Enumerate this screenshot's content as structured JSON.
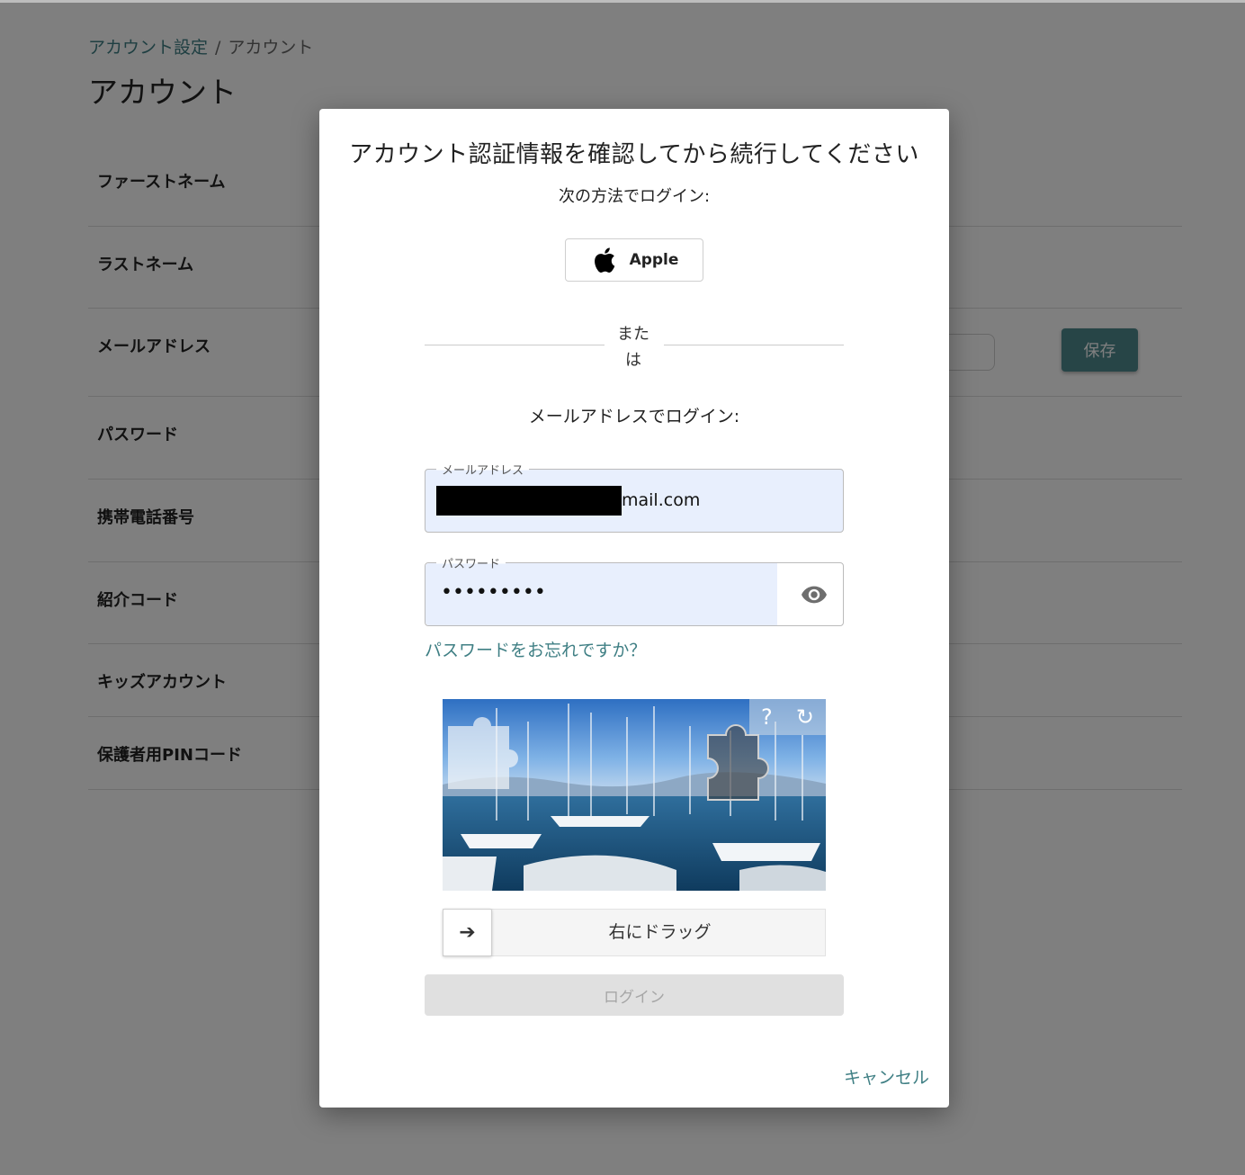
{
  "breadcrumb": {
    "parent": "アカウント設定",
    "separator": "/",
    "current": "アカウント"
  },
  "page_title": "アカウント",
  "settings_rows": [
    "ファーストネーム",
    "ラストネーム",
    "メールアドレス",
    "パスワード",
    "携帯電話番号",
    "紹介コード",
    "キッズアカウント",
    "保護者用PINコード"
  ],
  "save_label": "保存",
  "modal": {
    "title": "アカウント認証情報を確認してから続行してください",
    "sso_label": "次の方法でログイン:",
    "apple_label": "Apple",
    "divider": "または",
    "email_login_label": "メールアドレスでログイン:",
    "email_legend": "メールアドレス",
    "email_value_visible": "mail.com",
    "password_legend": "パスワード",
    "password_value": "•••••••••",
    "forgot_password": "パスワードをお忘れですか？",
    "slider_label": "右にドラッグ",
    "login_label": "ログイン",
    "cancel_label": "キャンセル"
  },
  "colors": {
    "accent": "#3f7f84",
    "save_bg": "#4f8a8f",
    "autofill_bg": "#e8effd",
    "disabled_bg": "#e0e0e0"
  },
  "icons": {
    "apple": "apple-logo-icon",
    "eye": "eye-icon",
    "help": "question-icon",
    "refresh": "refresh-icon",
    "arrow": "arrow-right-icon"
  }
}
